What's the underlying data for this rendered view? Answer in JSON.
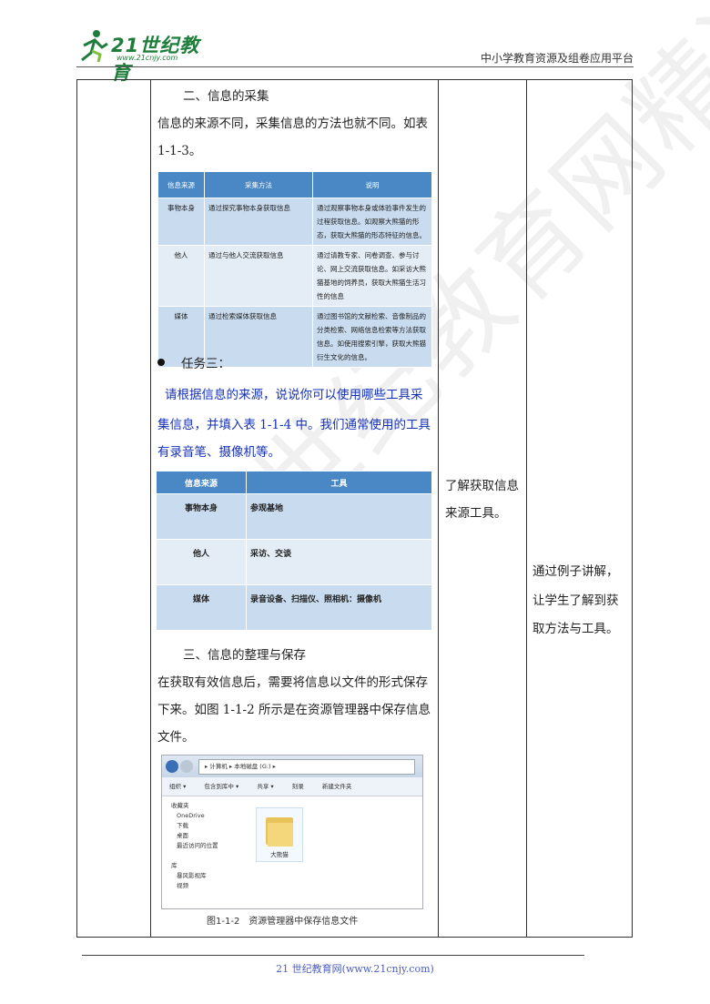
{
  "header": {
    "logo_text": "21世纪教育",
    "logo_url": "www.21cnjy.com",
    "right_text": "中小学教育资源及组卷应用平台"
  },
  "col2": {
    "heading_collect": "二、信息的采集",
    "para_collect_1": "信息的来源不同，采集信息的方法也就不同。如表",
    "para_collect_2": "1-1-3。",
    "table1": {
      "headers": [
        "信息来源",
        "采集方法",
        "说明"
      ],
      "rows": [
        {
          "source": "事物本身",
          "method": "通过探究事物本身获取信息",
          "note": "通过观察事物本身或体验事件发生的过程获取信息。如观察大熊猫的形态，获取大熊猫的形态特征的信息。"
        },
        {
          "source": "他人",
          "method": "通过与他人交流获取信息",
          "note": "通过请教专家、问卷调查、参与讨论、网上交流获取信息。如采访大熊猫基地的饲养员，获取大熊猫生活习性的信息"
        },
        {
          "source": "媒体",
          "method": "通过检索媒体获取信息",
          "note": "通过图书馆的文献检索、音像制品的分类检索、网络信息检索等方法获取信息。如使用搜索引擎，获取大熊猫衍生文化的信息。"
        }
      ]
    },
    "task_label": "任务三：",
    "task_text_1": "请根据信息的来源，说说你可以使用哪些工具采",
    "task_text_2": "集信息，并填入表 1-1-4 中。我们通常使用的工具",
    "task_text_3": "有录音笔、摄像机等。",
    "table2": {
      "headers": [
        "信息来源",
        "工具"
      ],
      "rows": [
        {
          "source": "事物本身",
          "tool": "参观基地"
        },
        {
          "source": "他人",
          "tool": "采访、交谈"
        },
        {
          "source": "媒体",
          "tool": "录音设备、扫描仪、照相机：摄像机"
        }
      ]
    },
    "heading_save": "三、信息的整理与保存",
    "para_save_1": "在获取有效信息后，需要将信息以文件的形式保存",
    "para_save_2": "下来。如图 1-1-2 所示是在资源管理器中保存信息",
    "para_save_3": "文件。",
    "explorer": {
      "address": "▸ 计算机 ▸ 本地磁盘 (G:) ▸",
      "toolbar": [
        "组织 ▾",
        "包含到库中 ▾",
        "共享 ▾",
        "刻录",
        "新建文件夹"
      ],
      "sidebar": [
        "收藏夹",
        "OneDrive",
        "下载",
        "桌面",
        "最近访问的位置",
        "",
        "库",
        "暴风影视库",
        "视频"
      ],
      "folder_name": "大熊猫"
    },
    "figure_caption": "图1-1-2　资源管理器中保存信息文件"
  },
  "col3": {
    "text_1": "了解获取信息",
    "text_2": "来源工具。"
  },
  "col4": {
    "text_1": "通过例子讲解，",
    "text_2": "让学生了解到获",
    "text_3": "取方法与工具。"
  },
  "footer": {
    "text": "21 世纪教育网(www.21cnjy.com)"
  },
  "watermark": {
    "text": "21世纪教育网精选资料"
  },
  "colors": {
    "table_header": "#4a87c5",
    "table_row": "#c9dcef",
    "logo_green": "#1e7d3a",
    "task_blue": "#1530b8"
  }
}
